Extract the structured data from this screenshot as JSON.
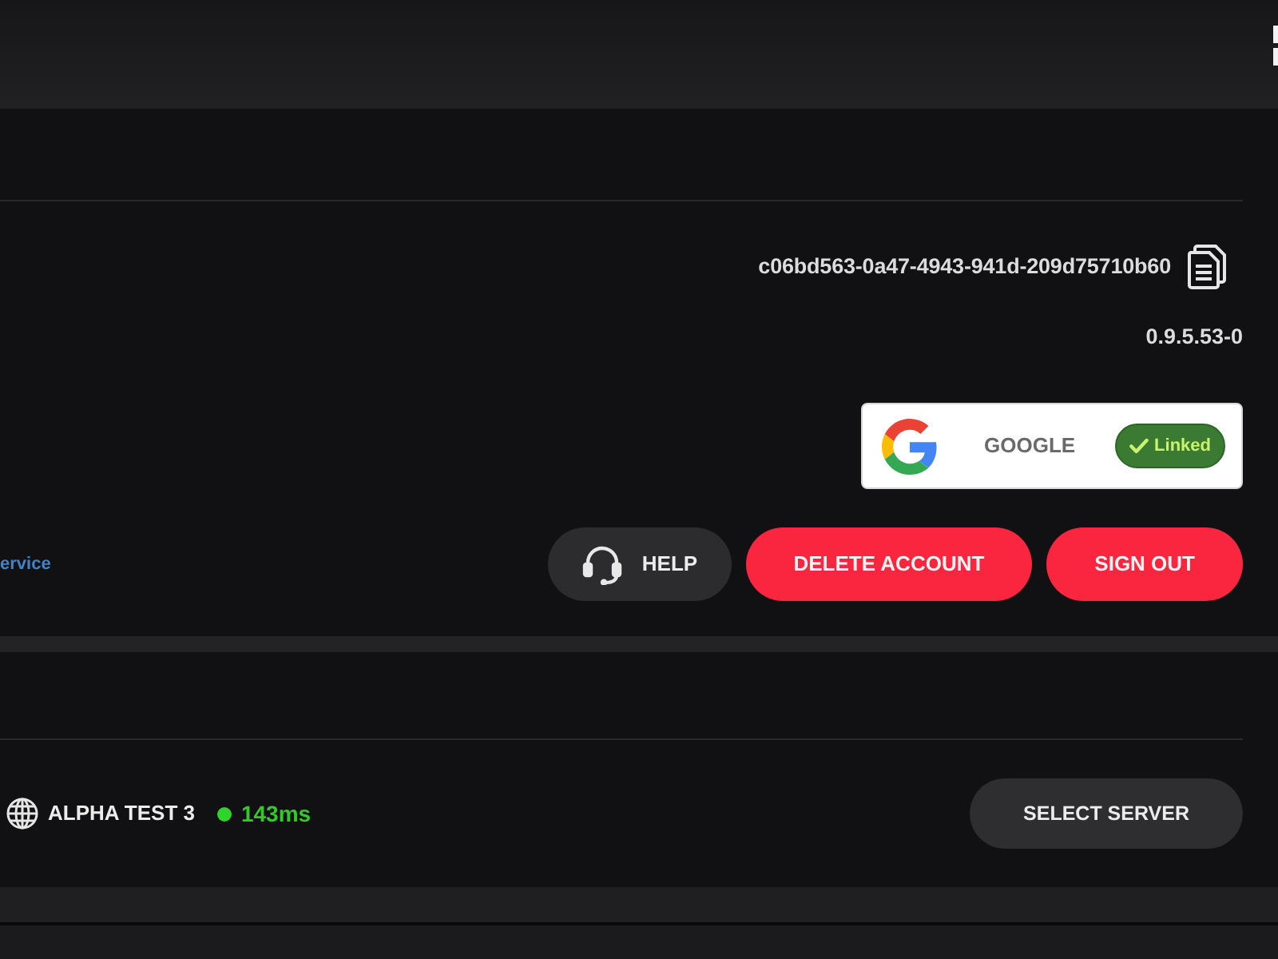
{
  "account": {
    "user_id": "c06bd563-0a47-4943-941d-209d75710b60",
    "version": "0.9.5.53-0",
    "linked_accounts": [
      {
        "provider": "GOOGLE",
        "status": "Linked",
        "linked": true
      }
    ],
    "link": "ervice",
    "buttons": [
      {
        "label": "HELP",
        "kind": "help"
      },
      {
        "label": "DELETE ACCOUNT",
        "kind": "danger"
      },
      {
        "label": "SIGN OUT",
        "kind": "danger"
      }
    ]
  },
  "server": {
    "name": "ALPHA TEST 3",
    "online": true,
    "ping": "143ms",
    "button": "SELECT SERVER"
  }
}
